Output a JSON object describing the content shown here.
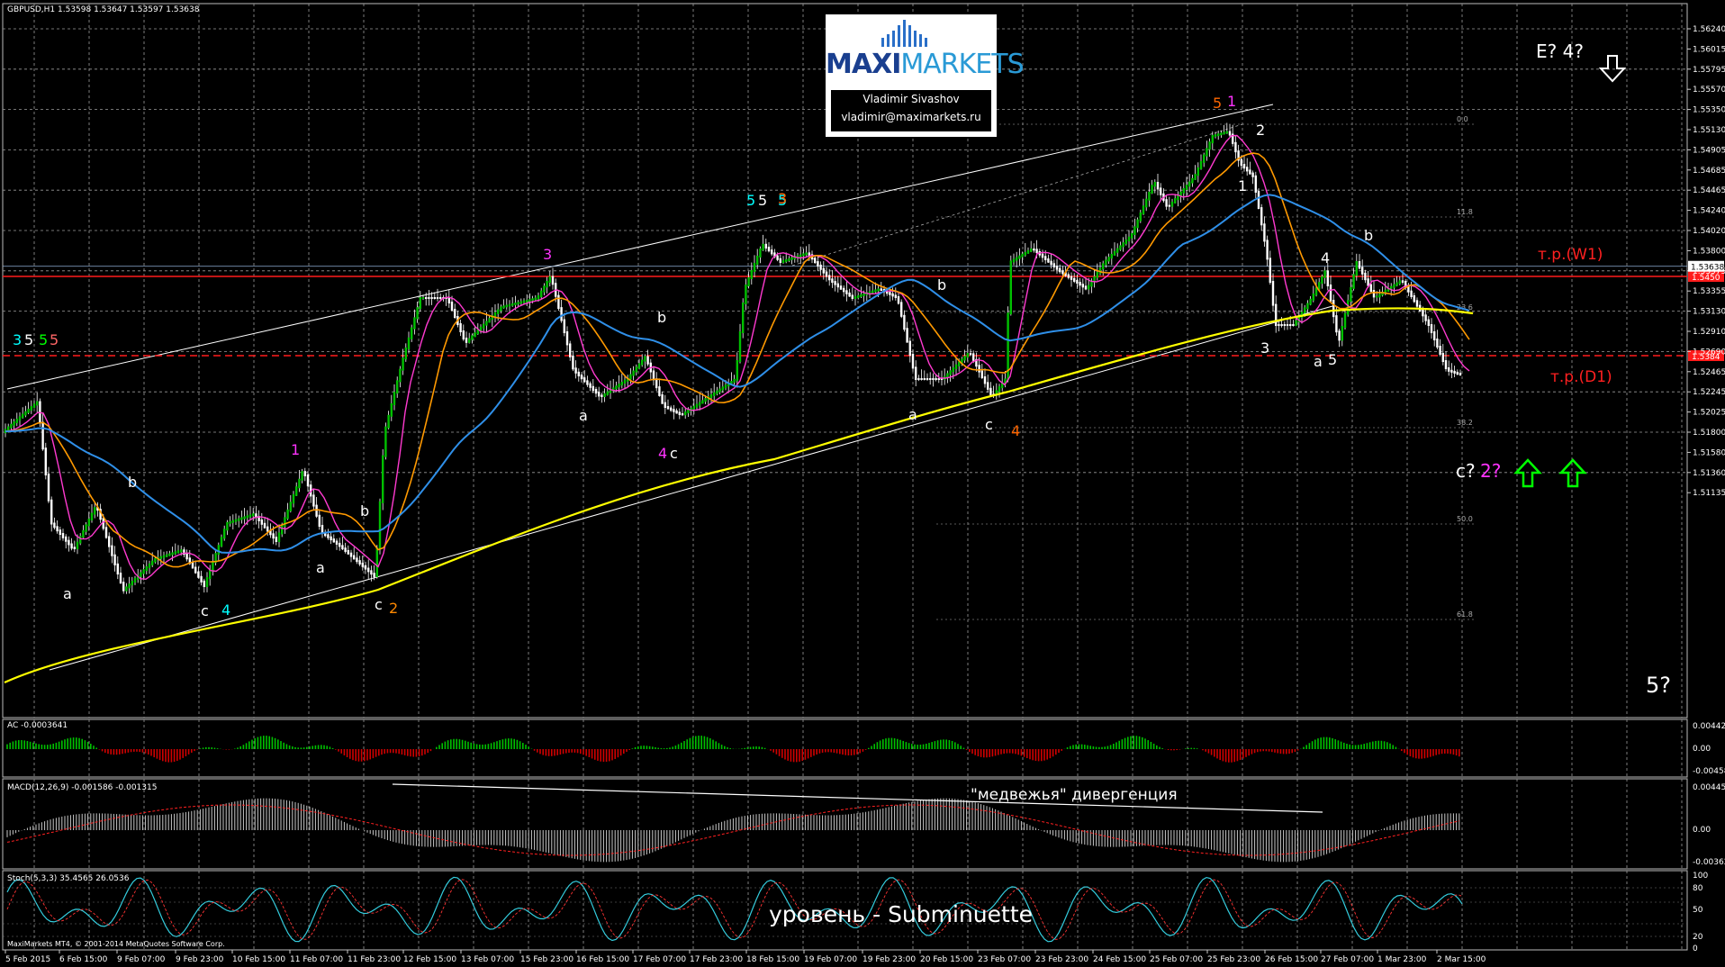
{
  "symbol_info": "GBPUSD,H1  1.53598 1.53647 1.53597 1.53638",
  "logo": {
    "brand_a": "MAXI",
    "brand_b": "MARKETS",
    "author": "Vladimir Sivashov",
    "email": "vladimir@maximarkets.ru"
  },
  "price_axis": [
    "1.56240",
    "1.56015",
    "1.55795",
    "1.55570",
    "1.55350",
    "1.55130",
    "1.54905",
    "1.54685",
    "1.54465",
    "1.54240",
    "1.54020",
    "1.53800",
    "1.53575",
    "1.53355",
    "1.53130",
    "1.52910",
    "1.52690",
    "1.52465",
    "1.52245",
    "1.52025",
    "1.51800",
    "1.51580",
    "1.51360",
    "1.51135"
  ],
  "current_price": "1.53638",
  "level_w1_price": "1.5450",
  "level_d1_price": "1.5384",
  "fib_levels": [
    "0.0",
    "11.8",
    "23.6",
    "38.2",
    "50.0",
    "61.8"
  ],
  "time_axis": [
    "5 Feb 2015",
    "6 Feb 15:00",
    "9 Feb 07:00",
    "9 Feb 23:00",
    "10 Feb 15:00",
    "11 Feb 07:00",
    "11 Feb 23:00",
    "12 Feb 15:00",
    "13 Feb 07:00",
    "15 Feb 23:00",
    "16 Feb 15:00",
    "17 Feb 07:00",
    "17 Feb 23:00",
    "18 Feb 15:00",
    "19 Feb 07:00",
    "19 Feb 23:00",
    "20 Feb 15:00",
    "23 Feb 07:00",
    "23 Feb 23:00",
    "24 Feb 15:00",
    "25 Feb 07:00",
    "25 Feb 23:00",
    "26 Feb 15:00",
    "27 Feb 07:00",
    "1 Mar 23:00",
    "2 Mar 15:00"
  ],
  "labels": {
    "level_w1": "т.р.(W1)",
    "level_d1": "т.р.(D1)",
    "forecast_e4": "E? 4?",
    "forecast_c": "c?",
    "forecast_2": "2?",
    "forecast_5": "5?",
    "divergence": "\"медвежья\" дивергенция",
    "level_name": "уровень - Subminuette"
  },
  "indicators": {
    "ac": {
      "label": "AC -0.0003641",
      "axis": [
        "0.004424",
        "0.00",
        "-0.004582"
      ]
    },
    "macd": {
      "label": "MACD(12,26,9) -0.001586 -0.001315",
      "axis": [
        "0.004453",
        "0.00",
        "-0.003627"
      ]
    },
    "stoch": {
      "label": "Stoch(5,3,3) 35.4565 26.0536",
      "axis": [
        "100",
        "80",
        "50",
        "20",
        "0"
      ]
    }
  },
  "copyright": "MaxiMarkets MT4, © 2001-2014 MetaQuotes Software Corp.",
  "colors": {
    "background": "#000000",
    "grid": "#9a9a9a",
    "level": "#ff1a1a",
    "ema_yellow": "#ffff00",
    "ema_blue": "#2f8fe8",
    "ema_orange": "#ff9900",
    "ema_magenta": "#ff3ad0",
    "up_arrow": "#00ff00"
  },
  "waves": [
    {
      "t": "3",
      "c": "#00ffff"
    },
    {
      "t": "5",
      "c": "#ffffff"
    },
    {
      "t": "5",
      "c": "#00ff00"
    },
    {
      "t": "5",
      "c": "#ff6666"
    },
    {
      "t": "a",
      "c": "#ffffff"
    },
    {
      "t": "b",
      "c": "#ffffff"
    },
    {
      "t": "c",
      "c": "#ffffff"
    },
    {
      "t": "4",
      "c": "#00ffff"
    },
    {
      "t": "1",
      "c": "#ff33ff"
    },
    {
      "t": "a",
      "c": "#ffffff"
    },
    {
      "t": "b",
      "c": "#ffffff"
    },
    {
      "t": "c",
      "c": "#ffffff"
    },
    {
      "t": "2",
      "c": "#ff8800"
    },
    {
      "t": "3",
      "c": "#ff33ff"
    },
    {
      "t": "a",
      "c": "#ffffff"
    },
    {
      "t": "b",
      "c": "#ffffff"
    },
    {
      "t": "4",
      "c": "#ff33ff"
    },
    {
      "t": "c",
      "c": "#ffffff"
    },
    {
      "t": "5",
      "c": "#00ffff"
    },
    {
      "t": "5",
      "c": "#ffffff"
    },
    {
      "t": "5",
      "c": "#00ffff"
    },
    {
      "t": "3",
      "c": "#ff6600"
    },
    {
      "t": "b",
      "c": "#ffffff"
    },
    {
      "t": "a",
      "c": "#ffffff"
    },
    {
      "t": "c",
      "c": "#ffffff"
    },
    {
      "t": "4",
      "c": "#ff6600"
    },
    {
      "t": "5",
      "c": "#ff6600"
    },
    {
      "t": "1",
      "c": "#ff33ff"
    },
    {
      "t": "2",
      "c": "#ffffff"
    },
    {
      "t": "1",
      "c": "#ffffff"
    },
    {
      "t": "3",
      "c": "#ffffff"
    },
    {
      "t": "4",
      "c": "#ffffff"
    },
    {
      "t": "a",
      "c": "#ffffff"
    },
    {
      "t": "5",
      "c": "#ffffff"
    },
    {
      "t": "b",
      "c": "#ffffff"
    }
  ]
}
